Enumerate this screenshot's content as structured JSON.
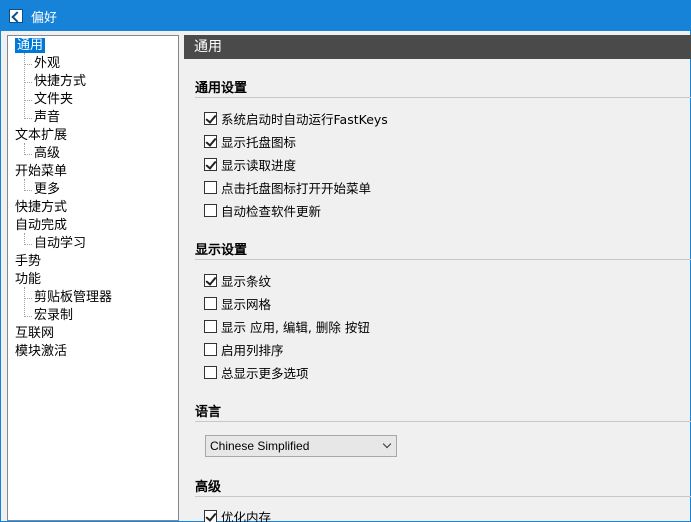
{
  "window": {
    "title": "偏好"
  },
  "sidebar": {
    "items": [
      {
        "label": "通用",
        "level": 0,
        "selected": true
      },
      {
        "label": "外观",
        "level": 1
      },
      {
        "label": "快捷方式",
        "level": 1
      },
      {
        "label": "文件夹",
        "level": 1
      },
      {
        "label": "声音",
        "level": 1
      },
      {
        "label": "文本扩展",
        "level": 0
      },
      {
        "label": "高级",
        "level": 1
      },
      {
        "label": "开始菜单",
        "level": 0
      },
      {
        "label": "更多",
        "level": 1
      },
      {
        "label": "快捷方式",
        "level": 0
      },
      {
        "label": "自动完成",
        "level": 0
      },
      {
        "label": "自动学习",
        "level": 1
      },
      {
        "label": "手势",
        "level": 0
      },
      {
        "label": "功能",
        "level": 0
      },
      {
        "label": "剪贴板管理器",
        "level": 1
      },
      {
        "label": "宏录制",
        "level": 1
      },
      {
        "label": "互联网",
        "level": 0
      },
      {
        "label": "模块激活",
        "level": 0
      }
    ]
  },
  "main": {
    "header": "通用",
    "general_settings": {
      "title": "通用设置",
      "options": [
        {
          "label": "系统启动时自动运行FastKeys",
          "checked": true
        },
        {
          "label": "显示托盘图标",
          "checked": true
        },
        {
          "label": "显示读取进度",
          "checked": true
        },
        {
          "label": "点击托盘图标打开开始菜单",
          "checked": false
        },
        {
          "label": "自动检查软件更新",
          "checked": false
        }
      ]
    },
    "display_settings": {
      "title": "显示设置",
      "options": [
        {
          "label": "显示条纹",
          "checked": true
        },
        {
          "label": "显示网格",
          "checked": false
        },
        {
          "label": "显示 应用, 编辑, 删除 按钮",
          "checked": false
        },
        {
          "label": "启用列排序",
          "checked": false
        },
        {
          "label": "总显示更多选项",
          "checked": false
        }
      ]
    },
    "language": {
      "title": "语言",
      "selected": "Chinese Simplified"
    },
    "advanced": {
      "title": "高级",
      "options": [
        {
          "label": "优化内存",
          "checked": true
        }
      ]
    }
  }
}
